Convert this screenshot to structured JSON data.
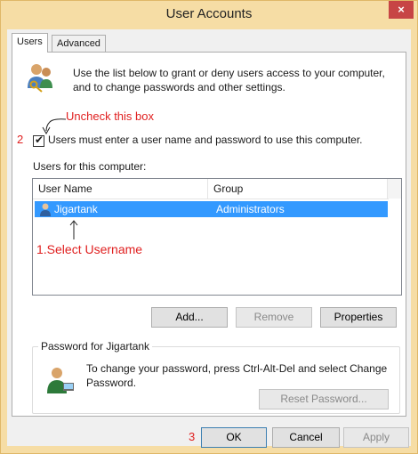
{
  "window": {
    "title": "User Accounts",
    "close_glyph": "×"
  },
  "tabs": [
    {
      "label": "Users"
    },
    {
      "label": "Advanced"
    }
  ],
  "intro": {
    "text": "Use the list below to grant or deny users access to your computer, and to change passwords and other settings."
  },
  "checkbox": {
    "label": "Users must enter a user name and password to use this computer.",
    "checked": true
  },
  "users_section": {
    "label": "Users for this computer:"
  },
  "list": {
    "columns": [
      "User Name",
      "Group"
    ],
    "rows": [
      {
        "name": "Jigartank",
        "group": "Administrators"
      }
    ]
  },
  "user_buttons": {
    "add": "Add...",
    "remove": "Remove",
    "properties": "Properties"
  },
  "password_group": {
    "legend": "Password for Jigartank",
    "text": "To change your password, press Ctrl-Alt-Del and select Change Password.",
    "reset_button": "Reset Password..."
  },
  "footer": {
    "ok": "OK",
    "cancel": "Cancel",
    "apply": "Apply"
  },
  "annotations": {
    "step2_number": "2",
    "uncheck_note": "Uncheck this box",
    "step1_note": "1.Select Username",
    "step3_number": "3"
  },
  "colors": {
    "annotation": "#e02020",
    "selection": "#3399ff",
    "frame": "#f6dda5"
  }
}
